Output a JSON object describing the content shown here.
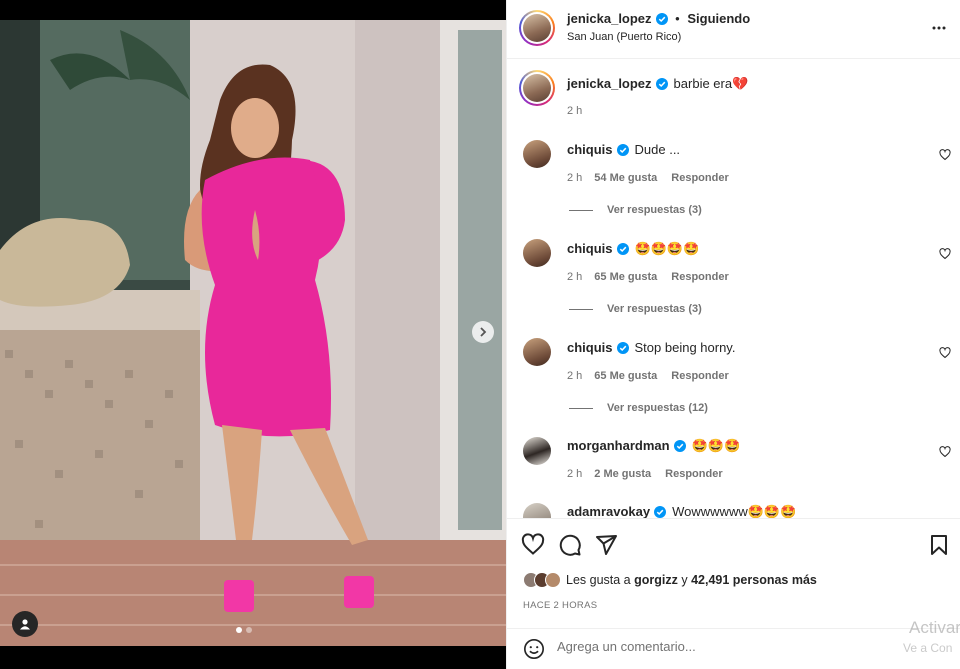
{
  "post": {
    "author": "jenicka_lopez",
    "follow_status": "Siguiendo",
    "bullet": "•",
    "location": "San Juan (Puerto Rico)",
    "caption": "barbie era💔",
    "caption_time": "2 h"
  },
  "comments": [
    {
      "user": "chiquis",
      "text": "Dude ...",
      "time": "2 h",
      "likes": "54 Me gusta",
      "reply": "Responder",
      "view_replies": "Ver respuestas (3)"
    },
    {
      "user": "chiquis",
      "text": "🤩🤩🤩🤩",
      "time": "2 h",
      "likes": "65 Me gusta",
      "reply": "Responder",
      "view_replies": "Ver respuestas (3)"
    },
    {
      "user": "chiquis",
      "text": "Stop being horny.",
      "time": "2 h",
      "likes": "65 Me gusta",
      "reply": "Responder",
      "view_replies": "Ver respuestas (12)"
    },
    {
      "user": "morganhardman",
      "text": "🤩🤩🤩",
      "time": "2 h",
      "likes": "2 Me gusta",
      "reply": "Responder"
    },
    {
      "user": "adamravokay",
      "text": "Wowwwwww🤩🤩🤩"
    }
  ],
  "likes_summary": {
    "prefix": "Les gusta a",
    "first_user": "gorgizz",
    "connector": "y",
    "rest": "42,491 personas más"
  },
  "time_ago": "HACE 2 HORAS",
  "comment_input": {
    "placeholder": "Agrega un comentario..."
  },
  "watermark": {
    "line1": "Activar",
    "line2": "Ve a Con"
  },
  "icons": [
    "more-options-icon",
    "heart-icon",
    "comment-icon",
    "share-icon",
    "save-icon",
    "emoji-icon",
    "verified-icon",
    "next-arrow-icon",
    "user-tag-icon"
  ],
  "colors": {
    "accent_blue": "#0095f6",
    "dress_pink": "#e8289a",
    "muted": "#737373"
  }
}
